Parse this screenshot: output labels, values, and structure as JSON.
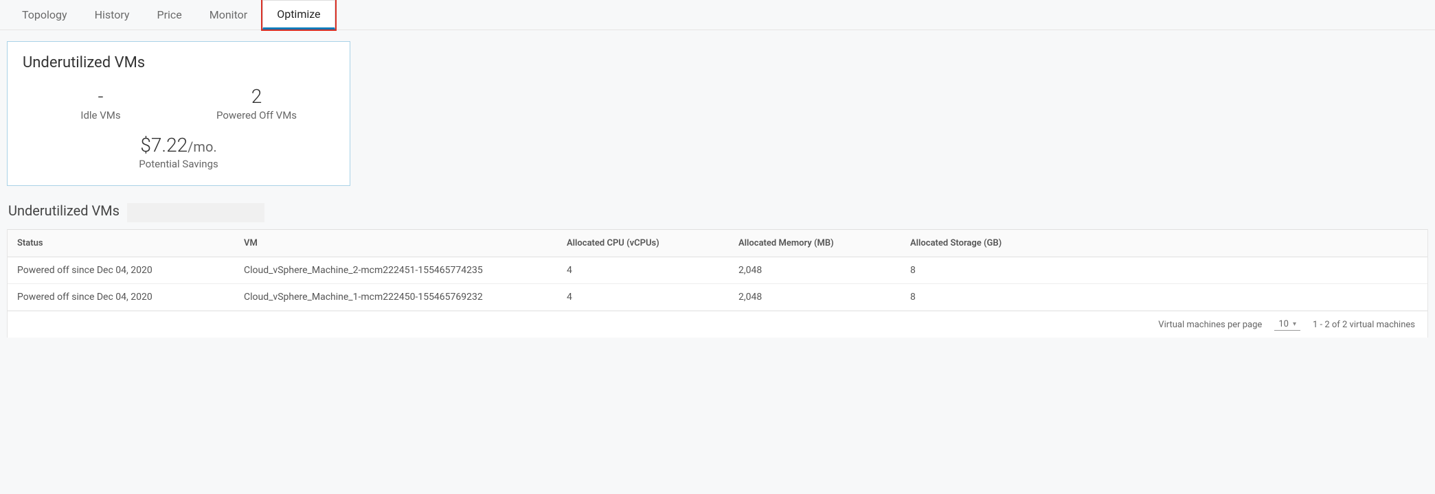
{
  "tabs": {
    "topology": "Topology",
    "history": "History",
    "price": "Price",
    "monitor": "Monitor",
    "optimize": "Optimize"
  },
  "card": {
    "title": "Underutilized VMs",
    "idle_value": "-",
    "idle_label": "Idle VMs",
    "powered_off_value": "2",
    "powered_off_label": "Powered Off VMs",
    "savings_amount": "$7.22",
    "savings_unit": "/mo.",
    "savings_label": "Potential Savings"
  },
  "section": {
    "title": "Underutilized VMs"
  },
  "table": {
    "headers": {
      "status": "Status",
      "vm": "VM",
      "cpu": "Allocated CPU (vCPUs)",
      "mem": "Allocated Memory (MB)",
      "stor": "Allocated Storage (GB)"
    },
    "rows": [
      {
        "status": "Powered off since Dec 04, 2020",
        "vm": "Cloud_vSphere_Machine_2-mcm222451-155465774235",
        "cpu": "4",
        "mem": "2,048",
        "stor": "8"
      },
      {
        "status": "Powered off since Dec 04, 2020",
        "vm": "Cloud_vSphere_Machine_1-mcm222450-155465769232",
        "cpu": "4",
        "mem": "2,048",
        "stor": "8"
      }
    ]
  },
  "pager": {
    "label": "Virtual machines per page",
    "value": "10",
    "range": "1 - 2 of 2 virtual machines"
  }
}
